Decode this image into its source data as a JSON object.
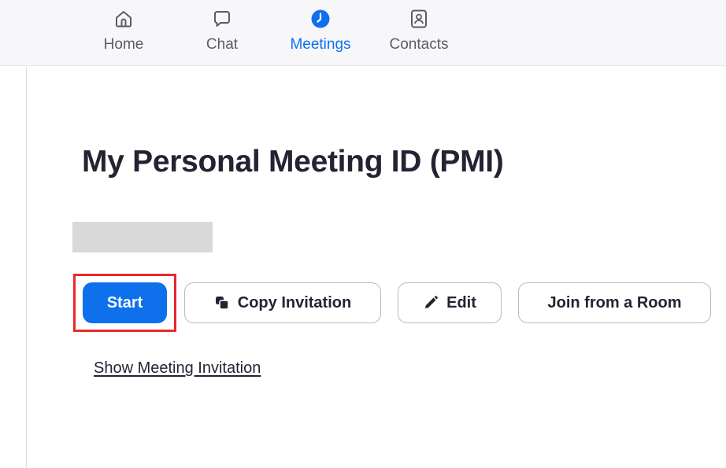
{
  "nav": {
    "tabs": [
      {
        "label": "Home",
        "icon": "home-icon",
        "active": false
      },
      {
        "label": "Chat",
        "icon": "chat-bubble-icon",
        "active": false
      },
      {
        "label": "Meetings",
        "icon": "clock-icon",
        "active": true
      },
      {
        "label": "Contacts",
        "icon": "contact-card-icon",
        "active": false
      }
    ]
  },
  "main": {
    "title": "My Personal Meeting ID (PMI)",
    "pmi_value": "",
    "buttons": {
      "start": "Start",
      "copy_invitation": "Copy Invitation",
      "edit": "Edit",
      "join_from_room": "Join from a Room"
    },
    "show_invitation_link": "Show Meeting Invitation"
  },
  "colors": {
    "accent": "#0e71eb",
    "highlight": "#e8292d",
    "text": "#232333",
    "nav_text": "#5b5b66",
    "redacted": "#d9d9d9"
  }
}
